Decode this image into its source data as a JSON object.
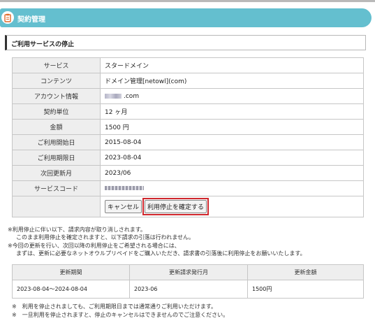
{
  "header": {
    "title": "契約管理",
    "icon": "clipboard-icon",
    "accent": "#64bfcf"
  },
  "section": {
    "title": "ご利用サービスの停止"
  },
  "info": {
    "rows": [
      {
        "label": "サービス",
        "value": "スタードメイン"
      },
      {
        "label": "コンテンツ",
        "value": "ドメイン管理[netowl](com)"
      },
      {
        "label": "アカウント情報",
        "value": ".com"
      },
      {
        "label": "契約単位",
        "value": "12 ヶ月"
      },
      {
        "label": "金額",
        "value": "1500 円"
      },
      {
        "label": "ご利用開始日",
        "value": "2015-08-04"
      },
      {
        "label": "ご利用期限日",
        "value": "2023-08-04"
      },
      {
        "label": "次回更新月",
        "value": "2023/06"
      },
      {
        "label": "サービスコード",
        "value": ""
      }
    ],
    "cancel_label": "キャンセル",
    "confirm_label": "利用停止を確定する",
    "highlight_color": "#d0282e"
  },
  "notes": [
    "※利用停止に伴い以下、請求内容が取り消しされます。",
    "このまま利用停止を確定されますと、以下請求の引落は行われません。",
    "※今回の更新を行い、次回以降の利用停止をご希望される場合には、",
    "まずは、更新に必要なネットオウルプリペイドをご購入いただき、請求書の引落後に利用停止をお願いいたします。"
  ],
  "periods": {
    "headers": [
      "更新期間",
      "更新請求発行月",
      "更新金額"
    ],
    "rows": [
      [
        "2023-08-04〜2024-08-04",
        "2023-06",
        "1500円"
      ]
    ]
  },
  "footer_notes": [
    "※　利用を停止されましても、ご利用期限日までは通常通りご利用いただけます。",
    "※　一旦利用を停止されますと、停止のキャンセルはできませんのでご注意ください。"
  ]
}
